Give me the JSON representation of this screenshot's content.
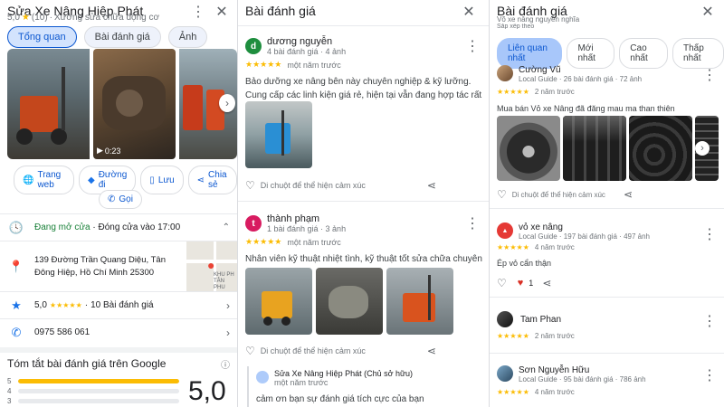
{
  "p1": {
    "title": "Sửa Xe Nâng Hiệp Phát",
    "rating": "5,0",
    "count": "(10)",
    "category": "Xưởng sửa chữa động cơ",
    "tabs": [
      "Tổng quan",
      "Bài đánh giá",
      "Ảnh"
    ],
    "video_time": "0:23",
    "actions": [
      "Trang web",
      "Đường đi",
      "Lưu",
      "Chia sẻ",
      "Gọi"
    ],
    "hours_open": "Đang mở cửa",
    "hours_close": " · Đóng cửa vào 17:00",
    "address": "139 Đường Trần Quang Diệu, Tân Đông Hiệp, Hồ Chí Minh 25300",
    "map_label": "KHU PH\nTÂN PHU",
    "rating_row": "5,0",
    "review_row": "10 Bài đánh giá",
    "phone": "0975 586 061",
    "summary_title": "Tóm tắt bài đánh giá trên Google",
    "bars": [
      {
        "label": "5",
        "fill": 1.0
      },
      {
        "label": "4",
        "fill": 0
      },
      {
        "label": "3",
        "fill": 0
      }
    ],
    "big_rating": "5,0"
  },
  "p2": {
    "title": "Bài đánh giá",
    "reviews": [
      {
        "initial": "d",
        "color": "#1e8e3e",
        "name": "dương nguyễn",
        "meta": "4 bài đánh giá · 4 ảnh",
        "time": "một năm trước",
        "text": "Bảo dưỡng xe nâng bên này chuyên nghiệp & kỹ lưỡng. Cung cấp các linh kiện giá rẻ, hiện tại vẫn đang hợp tác rất ok nha",
        "feedback": "Di chuột để thể hiện cảm xúc"
      },
      {
        "initial": "t",
        "color": "#d81b60",
        "name": "thành phạm",
        "meta": "1 bài đánh giá · 3 ảnh",
        "time": "một năm trước",
        "text": "Nhân viên kỹ thuật nhiệt tình, kỹ thuật tốt sửa chữa chuyên nghiệp.",
        "feedback": "Di chuột để thể hiện cảm xúc"
      }
    ],
    "owner": {
      "name": "Sửa Xe Nâng Hiệp Phát (Chủ sở hữu)",
      "time": "một năm trước",
      "text": "cảm ơn bạn sự đánh giá tích cực của bạn"
    }
  },
  "p3": {
    "title": "Bài đánh giá",
    "subtitle": "Võ xe nâng nguyễn nghĩa",
    "sort_label": "Sắp xếp theo",
    "filters": [
      "Liên quan nhất",
      "Mới nhất",
      "Cao nhất",
      "Thấp nhất"
    ],
    "reviews": [
      {
        "name": "Cường Vũ",
        "meta": "Local Guide · 26 bài đánh giá · 72 ảnh",
        "time": "2 năm trước",
        "text": "Mua bán Vỏ xe Nâng đã đăng mau ma than thiên",
        "feedback": "Di chuột để thể hiện cảm xúc"
      },
      {
        "name": "vỏ xe nâng",
        "meta": "Local Guide · 197 bài đánh giá · 497 ảnh",
        "time": "4 năm trước",
        "text": "Ép vỏ cẩn thận",
        "likes": "1"
      },
      {
        "name": "Tam Phan",
        "time": "2 năm trước"
      },
      {
        "name": "Sơn Nguyễn Hữu",
        "meta": "Local Guide · 95 bài đánh giá · 786 ảnh",
        "time": "4 năm trước"
      }
    ]
  }
}
